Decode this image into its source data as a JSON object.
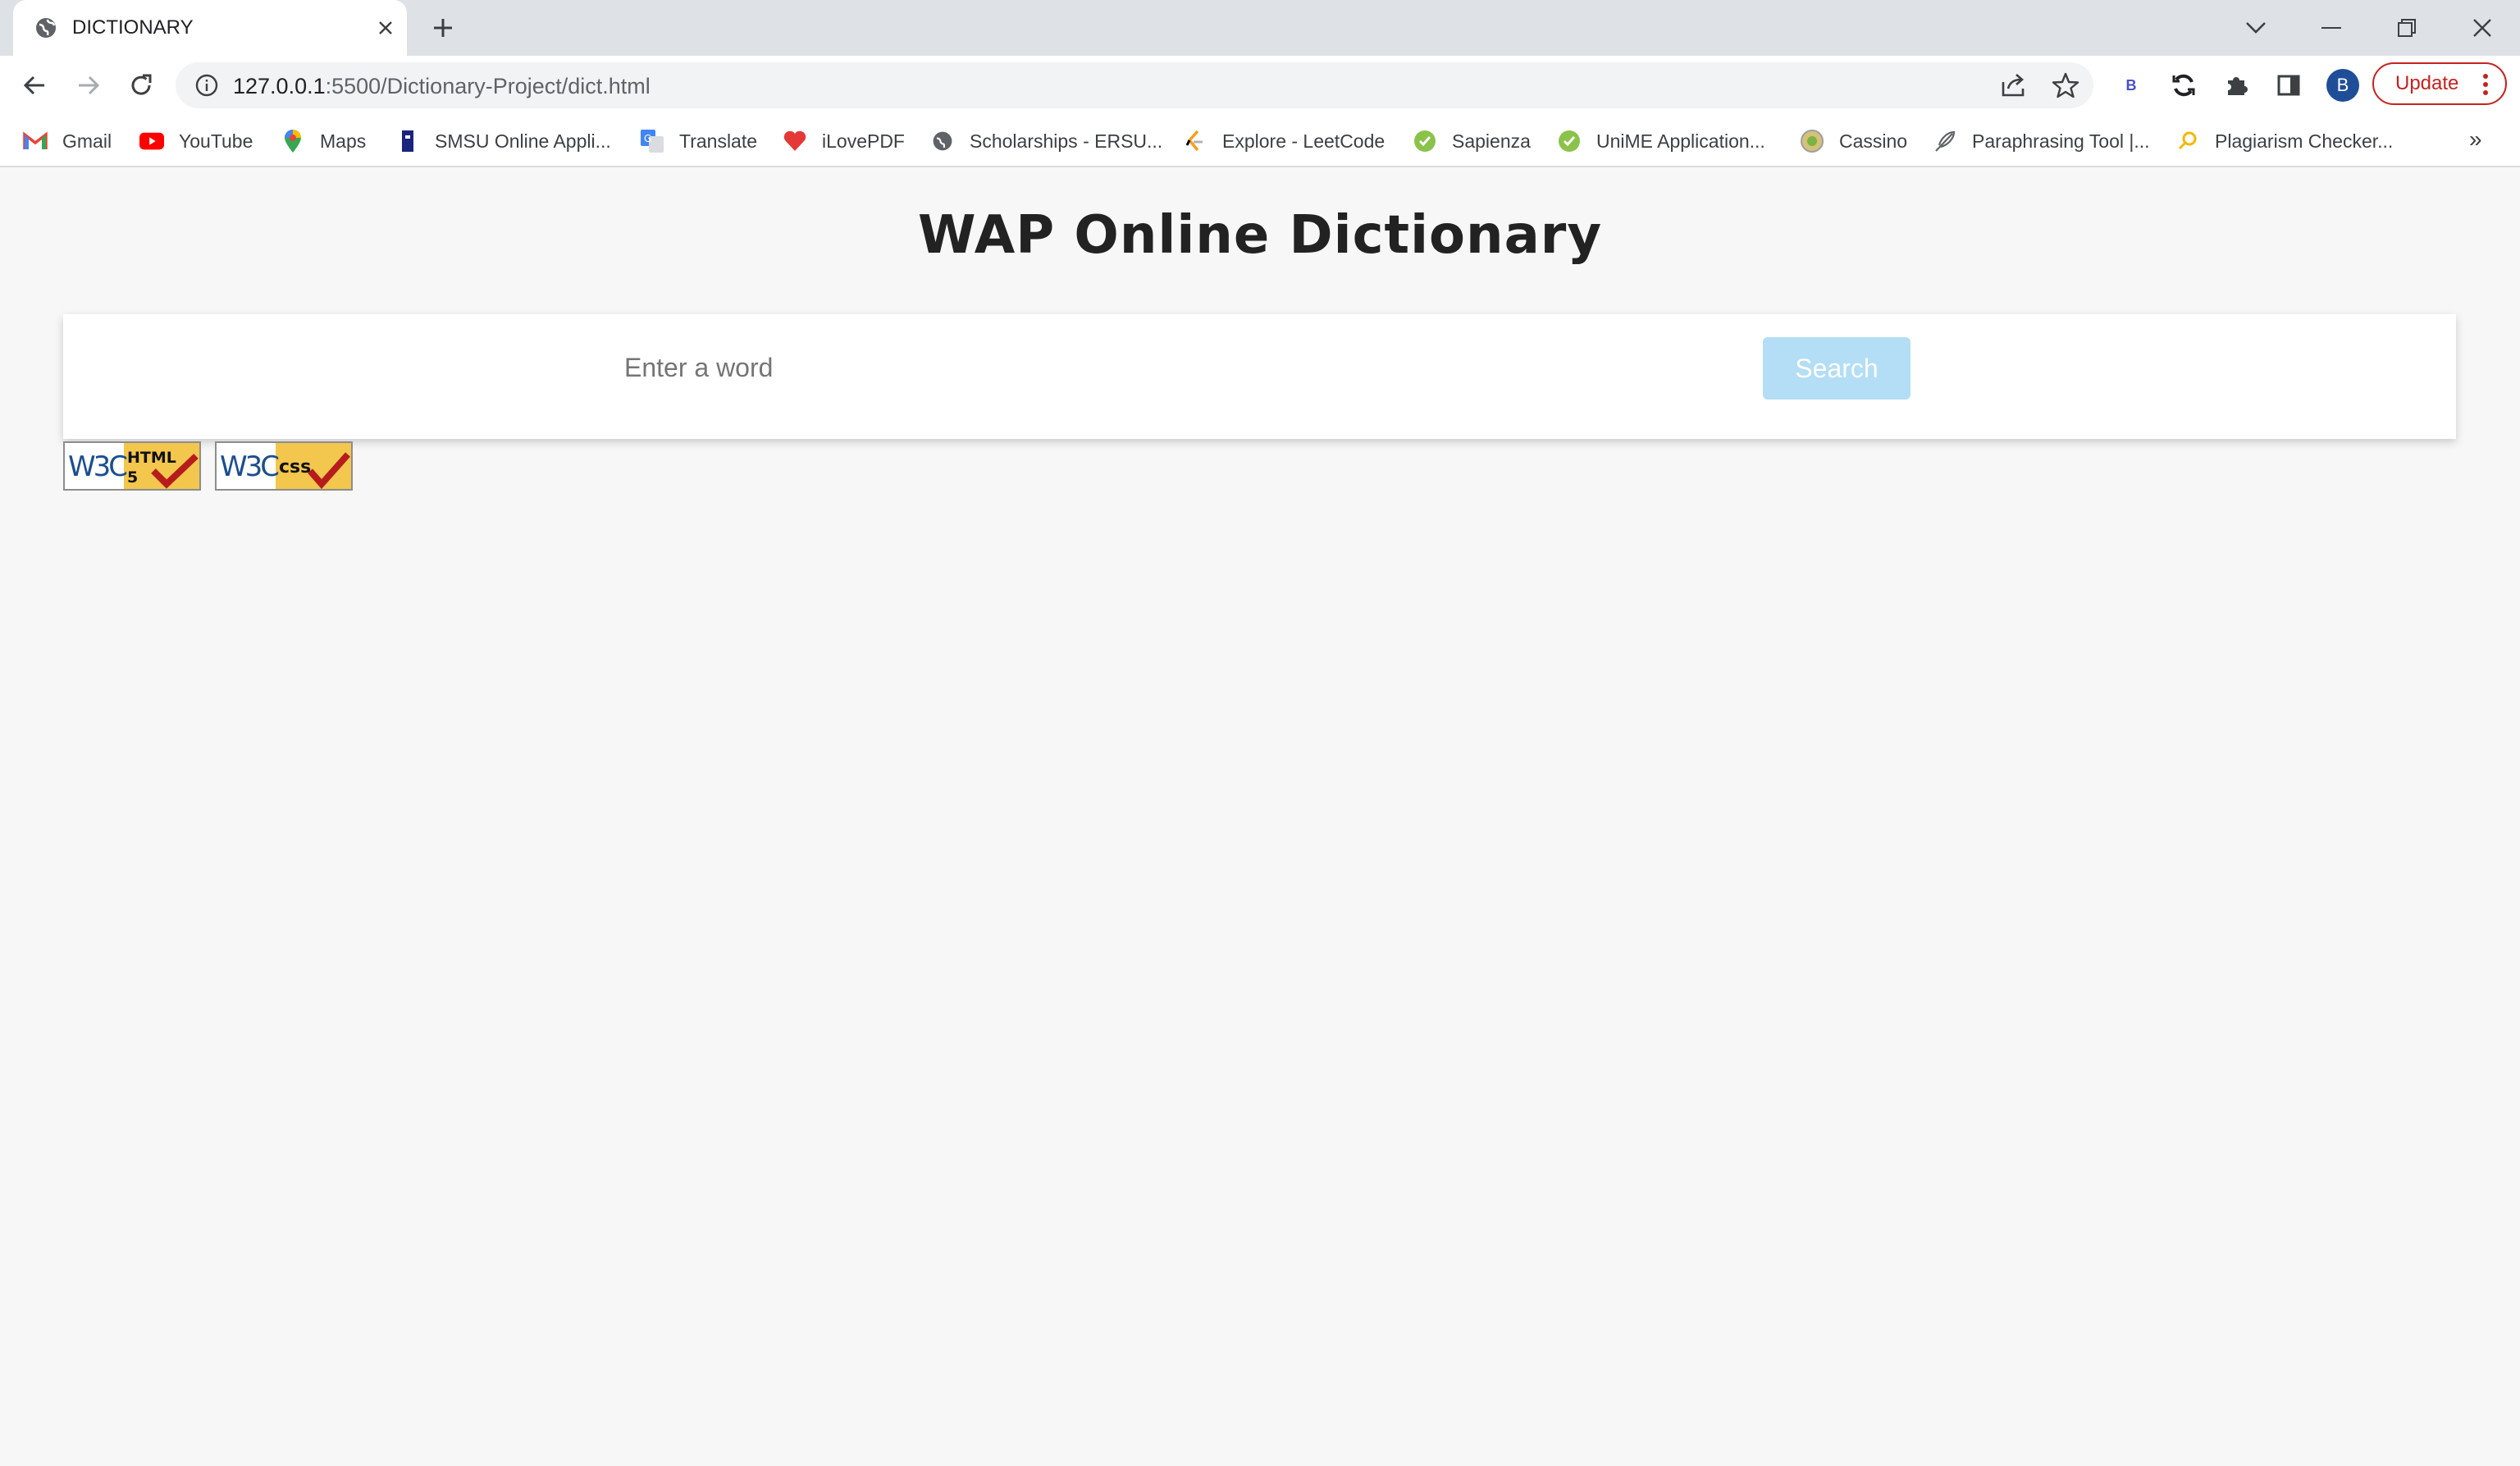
{
  "browser": {
    "tab_title": "DICTIONARY",
    "url_host": "127.0.0.1",
    "url_rest": ":5500/Dictionary-Project/dict.html",
    "avatar_letter": "B",
    "update_label": "Update",
    "extension_label": "B"
  },
  "bookmarks": [
    {
      "label": "Gmail",
      "icon": "gmail-icon"
    },
    {
      "label": "YouTube",
      "icon": "youtube-icon"
    },
    {
      "label": "Maps",
      "icon": "maps-icon"
    },
    {
      "label": "SMSU Online Appli...",
      "icon": "bookmark-flag-icon"
    },
    {
      "label": "Translate",
      "icon": "translate-icon"
    },
    {
      "label": "iLovePDF",
      "icon": "heart-icon"
    },
    {
      "label": "Scholarships - ERSU...",
      "icon": "globe-icon"
    },
    {
      "label": "Explore - LeetCode",
      "icon": "leetcode-icon"
    },
    {
      "label": "Sapienza",
      "icon": "check-circle-icon"
    },
    {
      "label": "UniME Application...",
      "icon": "check-circle-icon"
    },
    {
      "label": "Cassino",
      "icon": "seal-icon"
    },
    {
      "label": "Paraphrasing Tool |...",
      "icon": "feather-icon"
    },
    {
      "label": "Plagiarism Checker...",
      "icon": "magnifier-icon"
    }
  ],
  "bookmarks_more": "»",
  "page": {
    "title": "WAP Online Dictionary",
    "search_placeholder": "Enter a word",
    "search_button": "Search",
    "badges": [
      {
        "brand": "W3C",
        "tech": "HTML",
        "version": "5"
      },
      {
        "brand": "W3C",
        "tech": "css"
      }
    ]
  },
  "colors": {
    "page_bg": "#f7f7f7",
    "search_button_bg": "#b3def5",
    "update_red": "#c5221f",
    "avatar_blue": "#1f4e99"
  }
}
